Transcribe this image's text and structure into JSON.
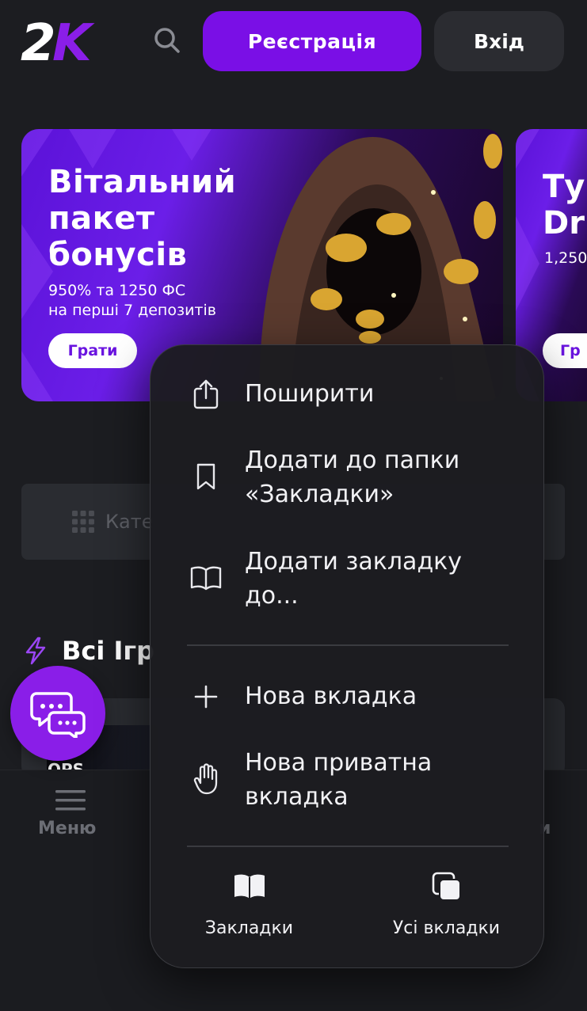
{
  "header": {
    "logo_text": "2K",
    "register_label": "Реєстрація",
    "login_label": "Вхід"
  },
  "banners": [
    {
      "title_lines": [
        "Вітальний",
        "пакет",
        "бонусів"
      ],
      "subtitle_lines": [
        "950% та 1250 ФС",
        "на перші 7 депозитів"
      ],
      "button_label": "Грати"
    },
    {
      "title_lines": [
        "Ту",
        "Dr"
      ],
      "subtitle": "1,250",
      "button_label": "Гр"
    }
  ],
  "category": {
    "label": "Кате"
  },
  "section": {
    "title": "Всі Ігр"
  },
  "game_card": {
    "thumb_text": "OPS"
  },
  "bottom_nav": {
    "menu_label": "Меню",
    "right_label": "и"
  },
  "context_menu": {
    "items": [
      {
        "icon": "share-icon",
        "label": "Поширити"
      },
      {
        "icon": "bookmark-icon",
        "label_lines": [
          "Додати до папки",
          "«Закладки»"
        ]
      },
      {
        "icon": "book-open-icon",
        "label_lines": [
          "Додати закладку",
          "до..."
        ]
      },
      {
        "icon": "plus-icon",
        "label": "Нова вкладка"
      },
      {
        "icon": "hand-icon",
        "label_lines": [
          "Нова приватна",
          "вкладка"
        ]
      }
    ],
    "footer": [
      {
        "icon": "bookmarks-book-icon",
        "label": "Закладки"
      },
      {
        "icon": "tabs-icon",
        "label": "Усі вкладки"
      }
    ]
  },
  "colors": {
    "background": "#1c1d21",
    "brand_purple": "#7a0fe6",
    "menu_bg": "#1c1c20",
    "text_primary": "#f2f2f5",
    "text_muted": "#6c6e75"
  }
}
